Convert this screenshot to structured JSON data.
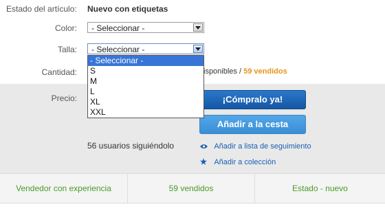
{
  "condition": {
    "label": "Estado del artículo:",
    "value": "Nuevo con etiquetas"
  },
  "color": {
    "label": "Color:",
    "selected": "- Seleccionar -"
  },
  "size": {
    "label": "Talla:",
    "selected": "- Seleccionar -",
    "options": [
      "- Seleccionar -",
      "S",
      "M",
      "L",
      "XL",
      "XXL"
    ]
  },
  "quantity": {
    "label": "Cantidad:",
    "available_text": "isponibles /",
    "sold_text": "59 vendidos"
  },
  "price": {
    "label": "Precio:"
  },
  "buy_now_label": "¡Cómpralo ya!",
  "add_to_cart_label": "Añadir a la cesta",
  "watchers_text": "56 usuarios siguiéndolo",
  "links": {
    "watchlist": "Añadir a lista de seguimiento",
    "collection": "Añadir a colección"
  },
  "bottom": {
    "seller": "Vendedor con experiencia",
    "sold": "59 vendidos",
    "state": "Estado - nuevo"
  },
  "colors": {
    "primary_button": "#1a65bb",
    "secondary_button": "#4a9ce0",
    "sold_highlight": "#e8921a",
    "bottom_text": "#4a9a27",
    "selection": "#3875d7"
  }
}
